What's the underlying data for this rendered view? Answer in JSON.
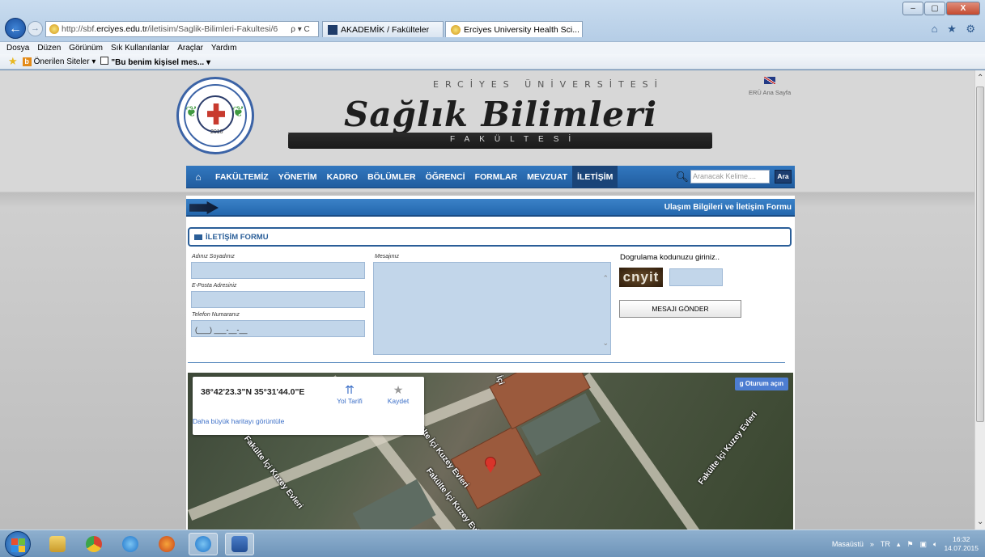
{
  "browser": {
    "address_url_prefix": "http://sbf.",
    "address_url_domain": "erciyes.edu.tr",
    "address_url_path": "/iletisim/Saglik-Bilimleri-Fakultesi/6",
    "address_actions": "ρ ▾ C",
    "tabs": [
      {
        "label": "AKADEMİK / Fakülteler",
        "active": false
      },
      {
        "label": "Erciyes University Health Sci...",
        "active": true
      }
    ],
    "menu": [
      "Dosya",
      "Düzen",
      "Görünüm",
      "Sık Kullanılanlar",
      "Araçlar",
      "Yardım"
    ],
    "favorites": {
      "suggested": "Önerilen Siteler ▾",
      "pinned": "\"Bu benim kişisel mes...",
      "pinned_arrow": "▾"
    },
    "window_controls": {
      "min": "–",
      "max": "▢",
      "close": "X"
    },
    "right_icons": "⌂ ★ ⚙"
  },
  "header": {
    "university": "ERCİYES ÜNİVERSİTESİ",
    "brand": "Sağlık Bilimleri",
    "fakulte": "FAKÜLTESİ",
    "logo_year": "2010",
    "eru_link": "ERÜ Ana Sayfa"
  },
  "nav": {
    "items": [
      "FAKÜLTEMİZ",
      "YÖNETİM",
      "KADRO",
      "BÖLÜMLER",
      "ÖĞRENCİ",
      "FORMLAR",
      "MEVZUAT",
      "İLETİŞİM"
    ],
    "active_index": 7,
    "search_placeholder": "Aranacak Kelime....",
    "search_button": "Ara"
  },
  "content": {
    "page_title": "Ulaşım Bilgileri ve İletişim Formu",
    "form_title": "İLETİŞİM FORMU",
    "labels": {
      "name": "Adınız Soyadınız",
      "email": "E-Posta Adresiniz",
      "phone": "Telefon Numaranız",
      "message": "Mesajınız"
    },
    "phone_mask": "(___) ___-__-__",
    "captcha_prompt": "Dogrulama kodunuzu giriniz..",
    "captcha_code": "cnyit",
    "send_button": "MESAJI GÖNDER"
  },
  "map": {
    "coords": "38°42'23.3\"N 35°31'44.0\"E",
    "route_label": "Yol Tarifi",
    "save_label": "Kaydet",
    "bigger_map": "Daha büyük haritayı görüntüle",
    "signin": "Oturum açın",
    "road_labels": [
      "Fakülte İçi Kuzey Evleri",
      "Fakülte İçi Kuzey Evleri",
      "Fakülte İçi Kuzey Evleri",
      "Fakülte İçi Kuzey Evleri"
    ],
    "road_label_short": "İçi"
  },
  "taskbar": {
    "desktop_label": "Masaüstü",
    "chevrons": "»",
    "lang": "TR",
    "time": "16:32",
    "date": "14.07.2015"
  }
}
